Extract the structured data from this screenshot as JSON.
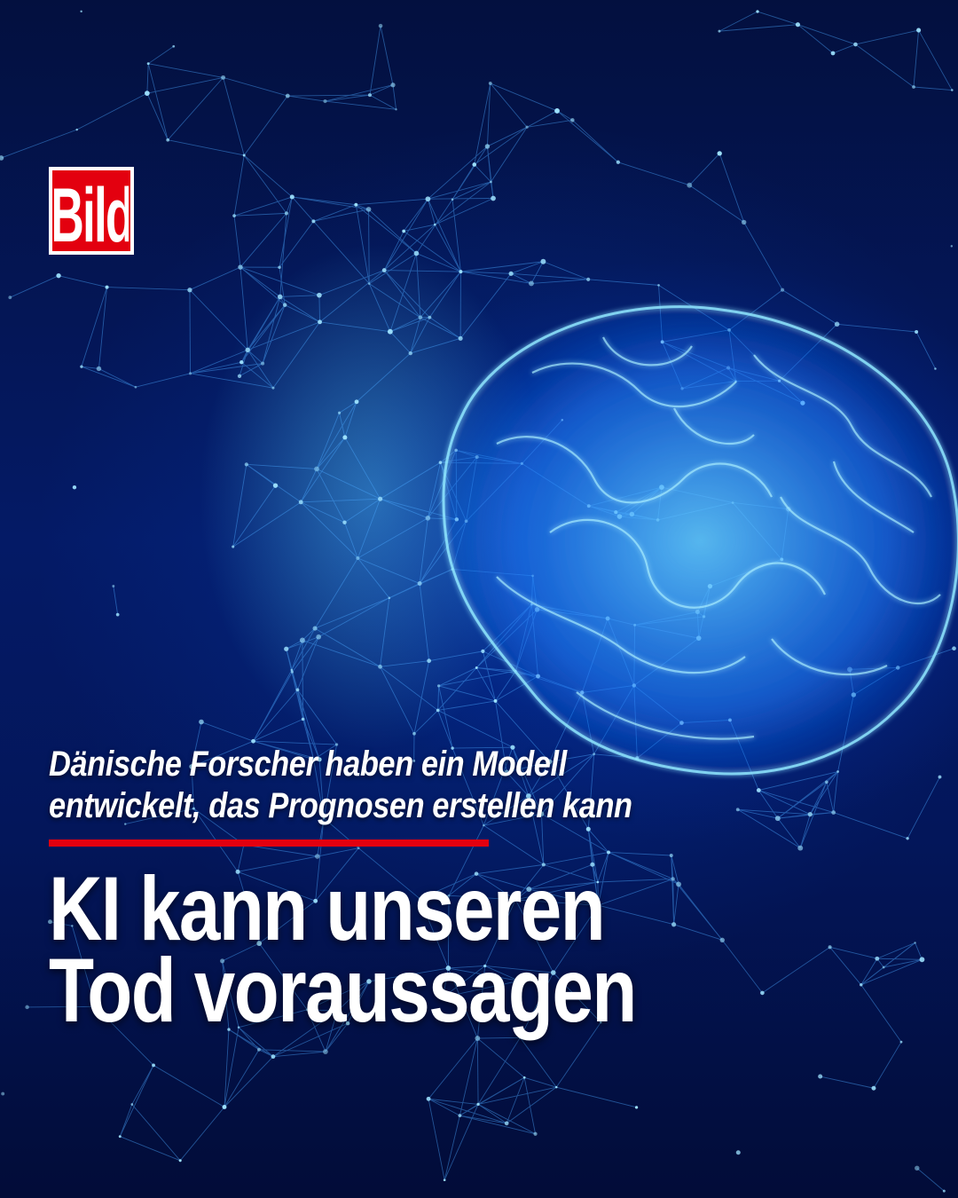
{
  "brand": {
    "logo_text": "Bild",
    "colors": {
      "red": "#e3000f",
      "white": "#ffffff"
    }
  },
  "background": {
    "description_icon": "glowing-brain-network-icon",
    "colors": {
      "deep_blue": "#041a66",
      "glow": "#5fd2ff"
    }
  },
  "subline": {
    "line1": "Dänische Forscher haben ein Modell",
    "line2": "entwickelt, das Prognosen erstellen kann"
  },
  "headline": {
    "line1": "KI kann unseren",
    "line2": "Tod voraussagen"
  }
}
